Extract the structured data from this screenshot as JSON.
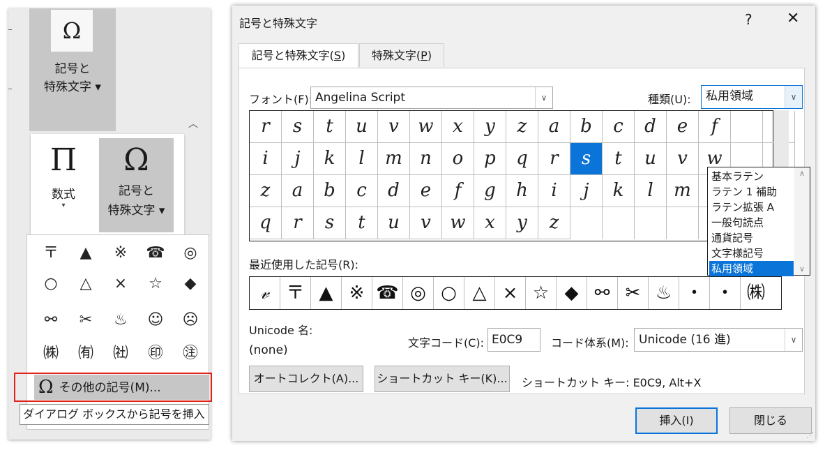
{
  "ribbon": {
    "big_button": {
      "icon": "omega-icon",
      "line1": "記号と",
      "line2": "特殊文字 ▾"
    },
    "math_button": {
      "icon": "pi-icon",
      "label": "数式",
      "arrow": "▾"
    },
    "symbol_button": {
      "icon": "omega-icon",
      "line1": "記号と",
      "line2": "特殊文字 ▾"
    },
    "collapse_icon": "chevron-up-icon"
  },
  "gallery": {
    "rows": [
      [
        "〒",
        "▲",
        "※",
        "☎",
        "◎"
      ],
      [
        "○",
        "△",
        "×",
        "☆",
        "◆"
      ],
      [
        "⚯",
        "✂",
        "♨",
        "☺",
        "☹"
      ],
      [
        "㈱",
        "㈲",
        "㈳",
        "㊞",
        "㊟"
      ]
    ],
    "more_symbols_label": "その他の記号(M)...",
    "more_symbols_key": "M",
    "tooltip": "ダイアログ ボックスから記号を挿入"
  },
  "dialog": {
    "title": "記号と特殊文字",
    "help": "?",
    "close": "✕",
    "tabs": [
      {
        "label": "記号と特殊文字(S)",
        "key": "S",
        "active": true
      },
      {
        "label": "特殊文字(P)",
        "key": "P",
        "active": false
      }
    ],
    "font_label": "フォント(F):",
    "font_value": "Angelina Script",
    "subset_label": "種類(U):",
    "subset_value": "私用領域",
    "subset_options": [
      "基本ラテン",
      "ラテン 1 補助",
      "ラテン拡張 A",
      "一般句読点",
      "通貨記号",
      "文字様記号",
      "私用領域"
    ],
    "subset_selected_index": 6,
    "grid_rows": [
      [
        "r",
        "s",
        "t",
        "u",
        "v",
        "w",
        "x",
        "y",
        "z",
        "a",
        "b",
        "c",
        "d",
        "e",
        "f",
        "",
        ""
      ],
      [
        "i",
        "j",
        "k",
        "l",
        "m",
        "n",
        "o",
        "p",
        "q",
        "r",
        "s",
        "t",
        "u",
        "v",
        "w",
        "",
        ""
      ],
      [
        "z",
        "a",
        "b",
        "c",
        "d",
        "e",
        "f",
        "g",
        "h",
        "i",
        "j",
        "k",
        "l",
        "m",
        "n",
        "",
        ""
      ],
      [
        "q",
        "r",
        "s",
        "t",
        "u",
        "v",
        "w",
        "x",
        "y",
        "z",
        "",
        "",
        "",
        "",
        "",
        "",
        ""
      ]
    ],
    "selected_cell": {
      "row": 1,
      "col": 10
    },
    "recent_label": "最近使用した記号(R):",
    "recent": [
      "𝓋",
      "〒",
      "▲",
      "※",
      "☎",
      "◎",
      "○",
      "△",
      "×",
      "☆",
      "◆",
      "⚯",
      "✂",
      "♨",
      "・",
      "・",
      "㈱"
    ],
    "unicode_name_label": "Unicode 名:",
    "unicode_name_value": "(none)",
    "char_code_label": "文字コード(C):",
    "char_code_value": "E0C9",
    "code_system_label": "コード体系(M):",
    "code_system_value": "Unicode (16 進)",
    "autocorrect_button": "オートコレクト(A)...",
    "shortcut_button": "ショートカット キー(K)...",
    "shortcut_text": "ショートカット キー: E0C9, Alt+X",
    "insert_button": "挿入(I)",
    "close_button": "閉じる"
  },
  "colors": {
    "accent": "#0a74d8",
    "highlight_border": "#e0221b",
    "ribbon_pressed": "#c7c7c7"
  }
}
